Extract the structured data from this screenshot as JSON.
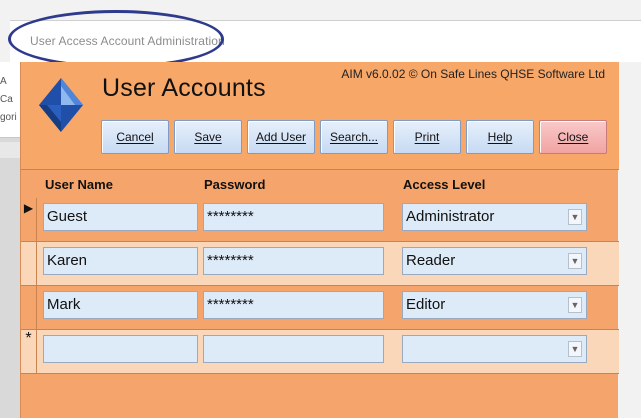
{
  "window": {
    "title": "User Access Account Administration"
  },
  "background": {
    "fragments": [
      "A",
      "Ca",
      "gori"
    ]
  },
  "header": {
    "heading": "User Accounts",
    "version": "AIM v6.0.02 © On Safe Lines QHSE Software Ltd"
  },
  "toolbar": {
    "cancel_label": "Cancel",
    "save_label": "Save",
    "add_user_label": "Add User",
    "search_label": "Search...",
    "print_label": "Print",
    "help_label": "Help",
    "close_label": "Close"
  },
  "columns": {
    "user_name": "User Name",
    "password": "Password",
    "access_level": "Access Level"
  },
  "rows": [
    {
      "selector": "▶",
      "user": "Guest",
      "password": "********",
      "access": "Administrator"
    },
    {
      "selector": "",
      "user": "Karen",
      "password": "********",
      "access": "Reader"
    },
    {
      "selector": "",
      "user": "Mark",
      "password": "********",
      "access": "Editor"
    },
    {
      "selector": "*",
      "user": "",
      "password": "",
      "access": ""
    }
  ],
  "colors": {
    "form_bg": "#f5a56b",
    "alt_row": "#f9d7b8",
    "field_bg": "#ddeaf8",
    "ellipse": "#2e3a8c"
  }
}
